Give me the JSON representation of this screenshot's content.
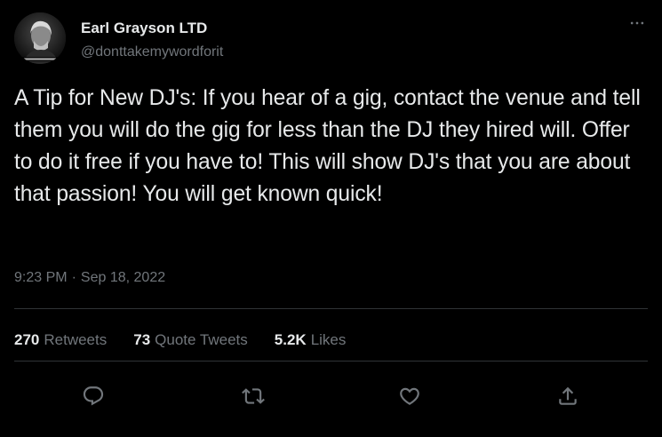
{
  "author": {
    "display_name": "Earl Grayson LTD",
    "handle": "@donttakemywordforit",
    "avatar_icon": "profile-photo"
  },
  "tweet": {
    "text": "A Tip for New DJ's: If you hear of a gig, contact the venue and tell them you will do the gig for less than the DJ they hired will. Offer to do it free if you have to! This will show DJ's that you are about that passion! You will get known quick!",
    "time": "9:23 PM",
    "separator": "·",
    "date": "Sep 18, 2022"
  },
  "stats": {
    "retweets_count": "270",
    "retweets_label": "Retweets",
    "quotes_count": "73",
    "quotes_label": "Quote Tweets",
    "likes_count": "5.2K",
    "likes_label": "Likes"
  },
  "actions": {
    "reply_icon": "reply-icon",
    "retweet_icon": "retweet-icon",
    "like_icon": "heart-icon",
    "share_icon": "share-icon",
    "more_icon": "more-icon"
  },
  "colors": {
    "background": "#000000",
    "text_primary": "#e7e9ea",
    "text_secondary": "#71767b",
    "divider": "#2f3336"
  }
}
